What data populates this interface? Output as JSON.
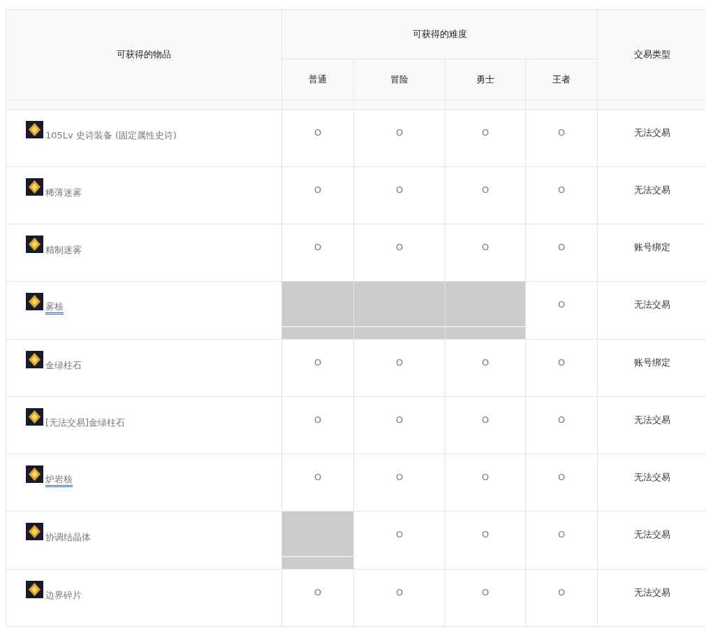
{
  "table": {
    "header": {
      "item": "可获得的物品",
      "difficulty": "可获得的难度",
      "levels": [
        "普通",
        "冒险",
        "勇士",
        "王者"
      ],
      "trade": "交易类型"
    },
    "rows": [
      {
        "item": "105Lv 史诗装备 (固定属性史诗)",
        "linked": false,
        "cells": [
          {
            "available": true,
            "mark": "O"
          },
          {
            "available": true,
            "mark": "O"
          },
          {
            "available": true,
            "mark": "O"
          },
          {
            "available": true,
            "mark": "O"
          }
        ],
        "trade": "无法交易"
      },
      {
        "item": "稀薄迷雾",
        "linked": false,
        "cells": [
          {
            "available": true,
            "mark": "O"
          },
          {
            "available": true,
            "mark": "O"
          },
          {
            "available": true,
            "mark": "O"
          },
          {
            "available": true,
            "mark": "O"
          }
        ],
        "trade": "无法交易"
      },
      {
        "item": "精制迷雾",
        "linked": false,
        "cells": [
          {
            "available": true,
            "mark": "O"
          },
          {
            "available": true,
            "mark": "O"
          },
          {
            "available": true,
            "mark": "O"
          },
          {
            "available": true,
            "mark": "O"
          }
        ],
        "trade": "账号绑定"
      },
      {
        "item": "雾核",
        "linked": true,
        "cells": [
          {
            "available": false
          },
          {
            "available": false
          },
          {
            "available": false
          },
          {
            "available": true,
            "mark": "O"
          }
        ],
        "trade": "无法交易"
      },
      {
        "item": "金绿柱石",
        "linked": false,
        "cells": [
          {
            "available": true,
            "mark": "O"
          },
          {
            "available": true,
            "mark": "O"
          },
          {
            "available": true,
            "mark": "O"
          },
          {
            "available": true,
            "mark": "O"
          }
        ],
        "trade": "账号绑定"
      },
      {
        "item": "[无法交易]金绿柱石",
        "linked": false,
        "cells": [
          {
            "available": true,
            "mark": "O"
          },
          {
            "available": true,
            "mark": "O"
          },
          {
            "available": true,
            "mark": "O"
          },
          {
            "available": true,
            "mark": "O"
          }
        ],
        "trade": "无法交易"
      },
      {
        "item": "炉岩核",
        "linked": true,
        "cells": [
          {
            "available": true,
            "mark": "O"
          },
          {
            "available": true,
            "mark": "O"
          },
          {
            "available": true,
            "mark": "O"
          },
          {
            "available": true,
            "mark": "O"
          }
        ],
        "trade": "无法交易"
      },
      {
        "item": "协调结晶体",
        "linked": false,
        "cells": [
          {
            "available": false
          },
          {
            "available": true,
            "mark": "O"
          },
          {
            "available": true,
            "mark": "O"
          },
          {
            "available": true,
            "mark": "O"
          }
        ],
        "trade": "无法交易"
      },
      {
        "item": "边界碎片",
        "linked": false,
        "cells": [
          {
            "available": true,
            "mark": "O"
          },
          {
            "available": true,
            "mark": "O"
          },
          {
            "available": true,
            "mark": "O"
          },
          {
            "available": true,
            "mark": "O"
          }
        ],
        "trade": "无法交易"
      }
    ]
  }
}
